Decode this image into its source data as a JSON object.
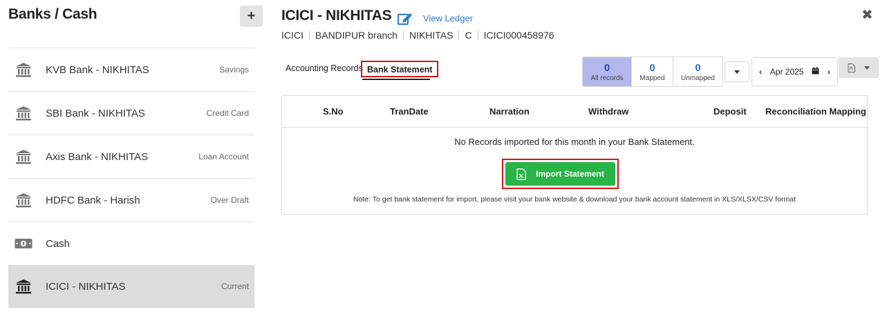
{
  "left": {
    "title": "Banks / Cash",
    "add_label": "+",
    "accounts": [
      {
        "name": "KVB Bank - NIKHITAS",
        "type": "Savings",
        "icon": "bank-icon"
      },
      {
        "name": "SBI Bank - NIKHITAS",
        "type": "Credit Card",
        "icon": "bank-icon"
      },
      {
        "name": "Axis Bank - NIKHITAS",
        "type": "Loan Account",
        "icon": "bank-icon"
      },
      {
        "name": "HDFC Bank - Harish",
        "type": "Over Draft",
        "icon": "bank-icon"
      },
      {
        "name": "Cash",
        "type": "",
        "icon": "cash-icon"
      },
      {
        "name": "ICICI - NIKHITAS",
        "type": "Current",
        "icon": "bank-icon",
        "active": true
      }
    ]
  },
  "header": {
    "title": "ICICI - NIKHITAS",
    "view_ledger": "View Ledger",
    "close": "✖",
    "meta": [
      "ICICI",
      "BANDIPUR branch",
      "NIKHITAS",
      "C",
      "ICICI000458976"
    ]
  },
  "tabs": {
    "accounting": "Accounting Records",
    "bank": "Bank Statement"
  },
  "filters": [
    {
      "count": "0",
      "label": "All records",
      "active": true
    },
    {
      "count": "0",
      "label": "Mapped"
    },
    {
      "count": "0",
      "label": "Unmapped"
    }
  ],
  "month": {
    "prev": "‹",
    "label": "Apr 2025",
    "next": "›"
  },
  "table": {
    "columns": [
      "S.No",
      "TranDate",
      "Narration",
      "Withdraw",
      "Deposit",
      "Reconciliation Mapping"
    ],
    "empty_message": "No Records imported for this month in your Bank Statement.",
    "import_label": "Import Statement",
    "note": "Note: To get bank statement for import, please visit your bank website & download your bank account statement in XLS/XLSX/CSV format"
  },
  "colors": {
    "accent_blue": "#2a7bc4",
    "import_green": "#28b446",
    "highlight_red": "#d11616",
    "active_filter": "#b3b8ec"
  }
}
